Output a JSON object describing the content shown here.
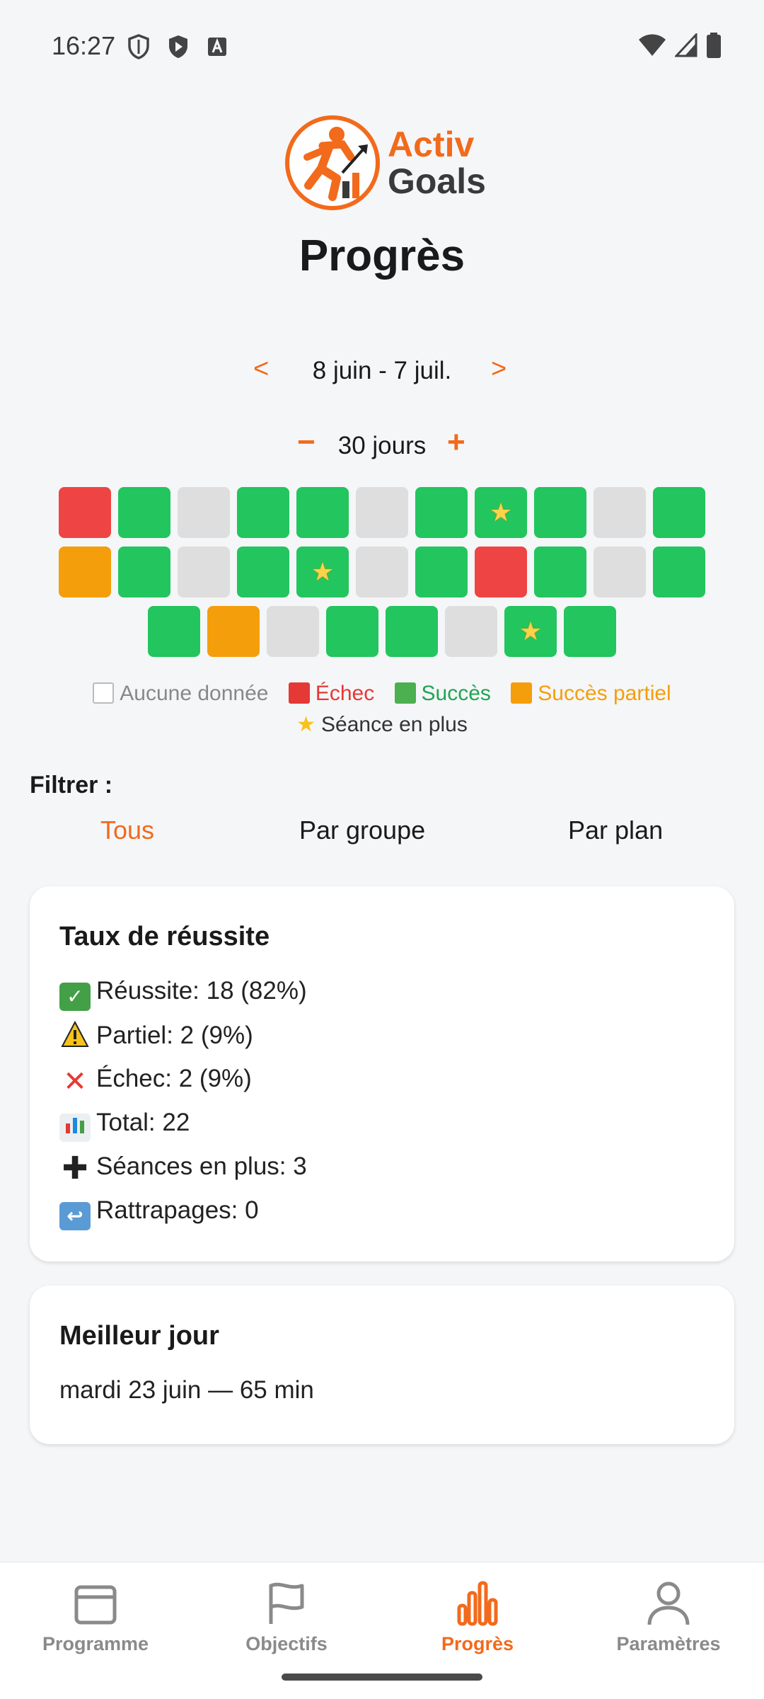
{
  "status_bar": {
    "time": "16:27"
  },
  "app": {
    "logo_line1": "Activ",
    "logo_line2": "Goals",
    "title": "Progrès"
  },
  "date_nav": {
    "prev": "<",
    "next": ">",
    "range": "8 juin - 7 juil."
  },
  "days_nav": {
    "minus": "−",
    "plus": "+",
    "label": "30 jours"
  },
  "colors": {
    "accent": "#f26a1b",
    "success": "#22c55e",
    "fail": "#ef4444",
    "partial": "#f59e0b",
    "none": "#dedede"
  },
  "heatmap": {
    "rows": [
      [
        "fail",
        "success",
        "none",
        "success",
        "success",
        "none",
        "success",
        "success-star",
        "success",
        "none",
        "success"
      ],
      [
        "partial",
        "success",
        "none",
        "success",
        "success-star",
        "none",
        "success",
        "fail",
        "success",
        "none",
        "success"
      ],
      [
        "success",
        "partial",
        "none",
        "success",
        "success",
        "none",
        "success-star",
        "success"
      ]
    ]
  },
  "legend": {
    "none": "Aucune donnée",
    "fail": "Échec",
    "success": "Succès",
    "partial": "Succès partiel",
    "extra": "Séance en plus"
  },
  "filter": {
    "label": "Filtrer :",
    "tabs": [
      "Tous",
      "Par groupe",
      "Par plan"
    ],
    "selected": "Tous"
  },
  "success_card": {
    "title": "Taux de réussite",
    "lines": [
      "Réussite: 18 (82%)",
      "Partiel: 2 (9%)",
      "Échec: 2 (9%)",
      "Total: 22",
      "Séances en plus: 3",
      "Rattrapages: 0"
    ]
  },
  "best_day_card": {
    "title": "Meilleur jour",
    "value": "mardi 23 juin — 65 min"
  },
  "bottom_nav": {
    "items": [
      "Programme",
      "Objectifs",
      "Progrès",
      "Paramètres"
    ],
    "active": "Progrès"
  }
}
